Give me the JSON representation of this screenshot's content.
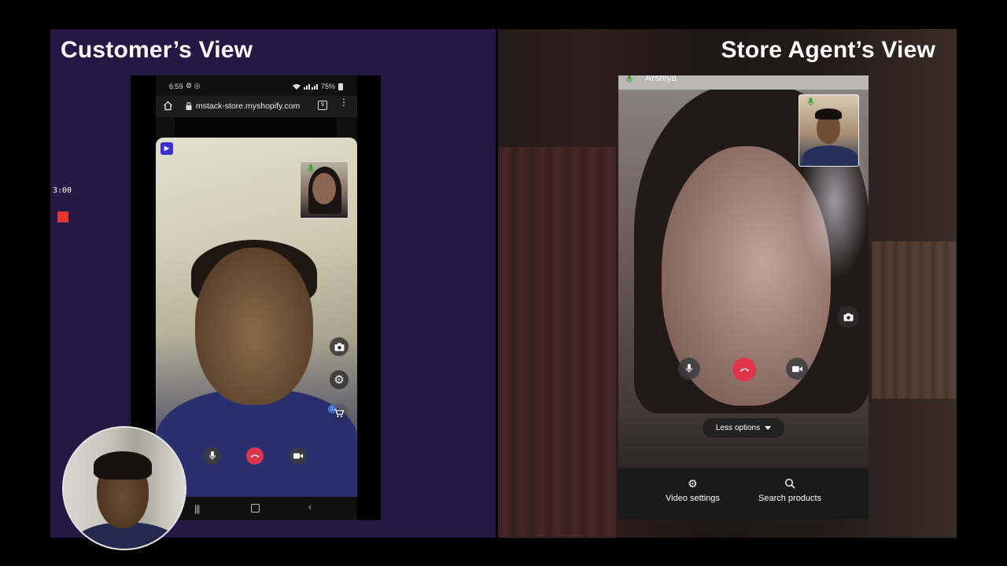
{
  "left": {
    "title": "Customer’s View",
    "rec_timer": "3:00",
    "status_bar": {
      "time": "6:59",
      "battery": "75%"
    },
    "browser": {
      "url": "mstack-store.myshopify.com",
      "tab_count": "9"
    },
    "call": {
      "cart_count": "1",
      "controls": [
        "mic",
        "end-call",
        "camera"
      ],
      "side_buttons": [
        "switch-camera",
        "settings",
        "cart"
      ]
    },
    "nav_bar": [
      "recents",
      "home",
      "back"
    ]
  },
  "right": {
    "title": "Store Agent’s View",
    "caller_name": "Arshiya",
    "less_options_label": "Less options",
    "bottom_actions": [
      {
        "label": "Video settings",
        "icon": "gear-icon"
      },
      {
        "label": "Search products",
        "icon": "search-icon"
      }
    ]
  },
  "colors": {
    "left_panel_bg": "#261844",
    "end_call_red": "#e0344a",
    "brand_purple": "#3b2fd1",
    "mic_green": "#3aa43a",
    "cart_badge_blue": "#3c7be8"
  }
}
